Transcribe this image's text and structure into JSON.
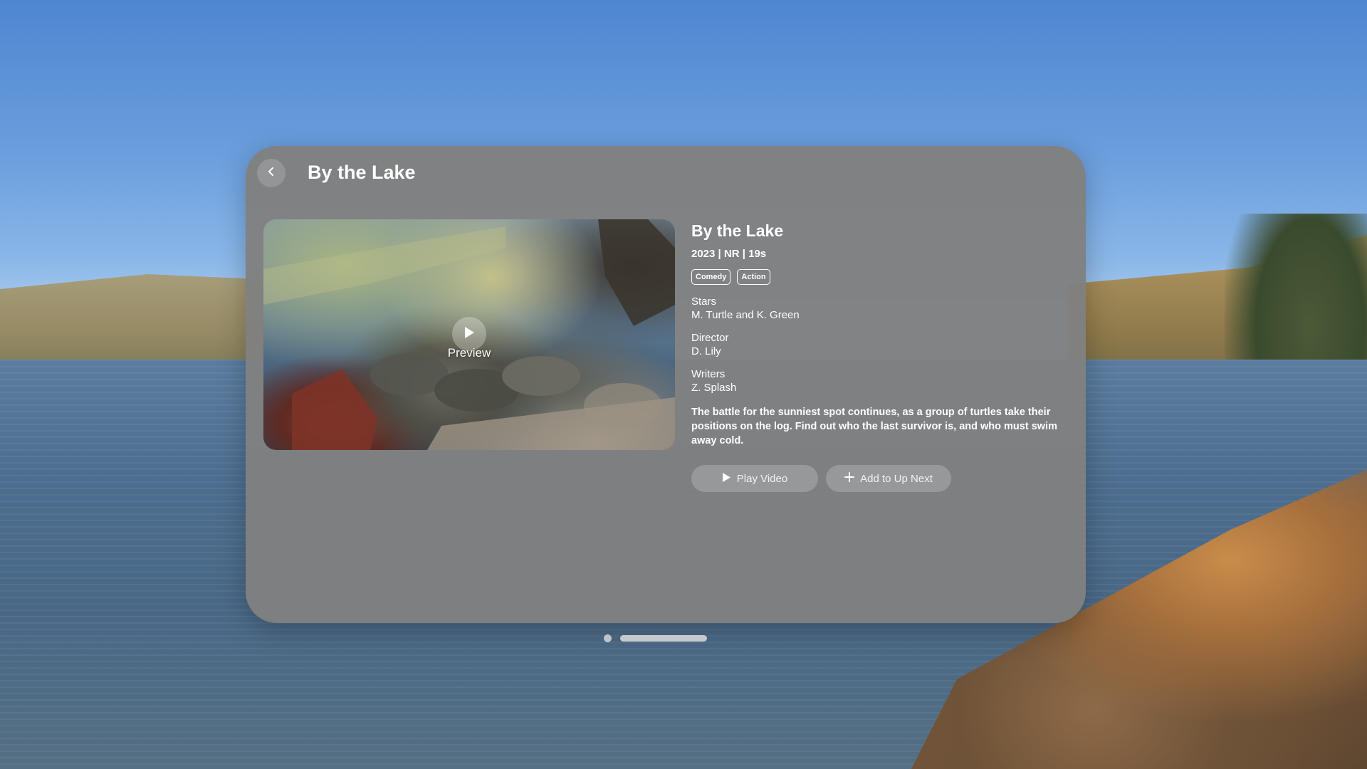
{
  "window": {
    "title": "By the Lake"
  },
  "preview": {
    "label": "Preview",
    "play_icon": "play-icon"
  },
  "details": {
    "title": "By the Lake",
    "meta": "2023 | NR | 19s",
    "tags": [
      "Comedy",
      "Action"
    ],
    "stars_label": "Stars",
    "stars": "M. Turtle and K. Green",
    "director_label": "Director",
    "director": "D. Lily",
    "writers_label": "Writers",
    "writers": "Z. Splash",
    "description": "The battle for the sunniest spot continues, as a group of turtles take their positions on the log. Find out who the last survivor is, and who must swim away cold."
  },
  "actions": {
    "play_label": "Play Video",
    "add_label": "Add to Up Next"
  },
  "icons": {
    "back": "chevron-left-icon",
    "play": "play-icon",
    "add": "plus-icon"
  }
}
